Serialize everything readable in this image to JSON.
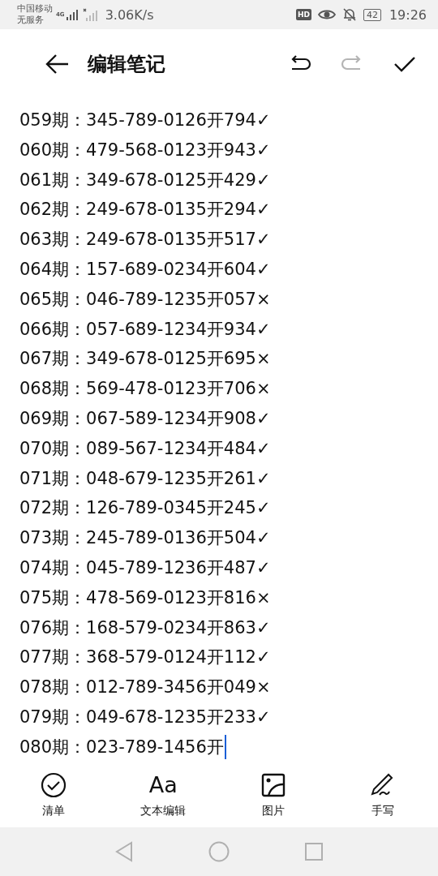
{
  "status_bar": {
    "carrier": "中国移动",
    "service": "无服务",
    "network": "4G",
    "speed": "3.06K/s",
    "hd": "HD",
    "battery": "42",
    "time": "19:26"
  },
  "header": {
    "title": "编辑笔记",
    "actions": [
      {
        "kind": "undo",
        "disabled": false
      },
      {
        "kind": "redo",
        "disabled": true
      },
      {
        "kind": "save",
        "disabled": false
      }
    ]
  },
  "lines": [
    {
      "text": "059期：345-789-0126开794✓",
      "cursor": false
    },
    {
      "text": "060期：479-568-0123开943✓",
      "cursor": false
    },
    {
      "text": "061期：349-678-0125开429✓",
      "cursor": false
    },
    {
      "text": "062期：249-678-0135开294✓",
      "cursor": false
    },
    {
      "text": "063期：249-678-0135开517✓",
      "cursor": false
    },
    {
      "text": "064期：157-689-0234开604✓",
      "cursor": false
    },
    {
      "text": "065期：046-789-1235开057×",
      "cursor": false
    },
    {
      "text": "066期：057-689-1234开934✓",
      "cursor": false
    },
    {
      "text": "067期：349-678-0125开695×",
      "cursor": false
    },
    {
      "text": "068期：569-478-0123开706×",
      "cursor": false
    },
    {
      "text": "069期：067-589-1234开908✓",
      "cursor": false
    },
    {
      "text": "070期：089-567-1234开484✓",
      "cursor": false
    },
    {
      "text": "071期：048-679-1235开261✓",
      "cursor": false
    },
    {
      "text": "072期：126-789-0345开245✓",
      "cursor": false
    },
    {
      "text": "073期：245-789-0136开504✓",
      "cursor": false
    },
    {
      "text": "074期：045-789-1236开487✓",
      "cursor": false
    },
    {
      "text": "075期：478-569-0123开816×",
      "cursor": false
    },
    {
      "text": "076期：168-579-0234开863✓",
      "cursor": false
    },
    {
      "text": "077期：368-579-0124开112✓",
      "cursor": false
    },
    {
      "text": "078期：012-789-3456开049×",
      "cursor": false
    },
    {
      "text": "079期：049-678-1235开233✓",
      "cursor": false
    },
    {
      "text": "080期：023-789-1456开",
      "cursor": true
    }
  ],
  "toolbar": [
    {
      "kind": "checklist",
      "label": "清单"
    },
    {
      "kind": "text",
      "glyph": "Aa",
      "label": "文本编辑"
    },
    {
      "kind": "image",
      "label": "图片"
    },
    {
      "kind": "handwriting",
      "label": "手写"
    }
  ]
}
